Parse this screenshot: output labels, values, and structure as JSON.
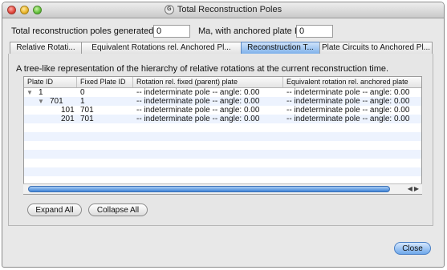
{
  "window": {
    "title": "Total Reconstruction Poles",
    "app_icon_glyph": "G"
  },
  "header": {
    "label_time": "Total reconstruction poles generated at",
    "time_value": "0",
    "label_anchor": "Ma, with anchored plate ID",
    "anchor_value": "0"
  },
  "tabs": [
    {
      "label": "Relative Rotati..."
    },
    {
      "label": "Equivalent Rotations rel. Anchored Pl..."
    },
    {
      "label": "Reconstruction T..."
    },
    {
      "label": "Plate Circuits to Anchored Pl..."
    }
  ],
  "panel": {
    "description": "A tree-like representation of the hierarchy of relative rotations at the current reconstruction time."
  },
  "table": {
    "columns": [
      "Plate ID",
      "Fixed Plate ID",
      "Rotation rel. fixed (parent) plate",
      "Equivalent rotation rel. anchored plate"
    ],
    "rows": [
      {
        "plate_id": "1",
        "fixed": "0",
        "rot_rel_fixed": "-- indeterminate pole --   angle: 0.00",
        "rot_rel_anchor": "-- indeterminate pole --   angle: 0.00"
      },
      {
        "plate_id": "701",
        "fixed": "1",
        "rot_rel_fixed": "-- indeterminate pole --   angle: 0.00",
        "rot_rel_anchor": "-- indeterminate pole --   angle: 0.00"
      },
      {
        "plate_id": "101",
        "fixed": "701",
        "rot_rel_fixed": "-- indeterminate pole --   angle: 0.00",
        "rot_rel_anchor": "-- indeterminate pole --   angle: 0.00"
      },
      {
        "plate_id": "201",
        "fixed": "701",
        "rot_rel_fixed": "-- indeterminate pole --   angle: 0.00",
        "rot_rel_anchor": "-- indeterminate pole --   angle: 0.00"
      }
    ]
  },
  "buttons": {
    "expand_all": "Expand All",
    "collapse_all": "Collapse All",
    "close": "Close"
  },
  "colors": {
    "selected_tab": "#7fb1ea",
    "scroll_thumb": "#3f84d8",
    "alt_row": "#edf3fe"
  }
}
